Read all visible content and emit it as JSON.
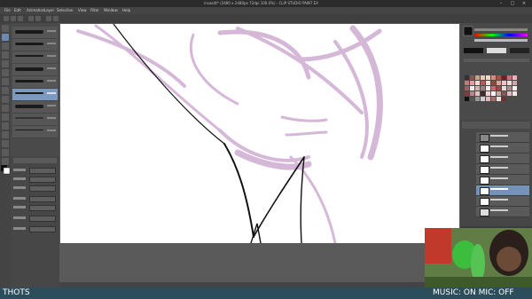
{
  "window": {
    "title": "insaaitt* (2480 x 2480px 72dpi 100.0%) - CLIP STUDIO PAINT EX",
    "minimize_icon": "minimize-icon",
    "maximize_icon": "maximize-icon",
    "close_icon": "close-icon"
  },
  "menu": {
    "items": [
      "File",
      "Edit",
      "Animation",
      "Layer",
      "Selection",
      "View",
      "Filter",
      "Window",
      "Help"
    ]
  },
  "tool_palette": {
    "icons": [
      "pen-icon",
      "pencil-icon",
      "brush-icon",
      "eraser-icon",
      "fill-icon",
      "select-icon",
      "move-icon",
      "eyedropper-icon",
      "hand-icon",
      "zoom-icon",
      "text-icon",
      "figure-icon",
      "lasso-icon",
      "ruler-icon",
      "gradient-icon",
      "blend-icon"
    ]
  },
  "colors": {
    "accent": "#7b9ac0",
    "canvas": "#ffffff",
    "sketch_stroke": "#b37fb9",
    "ink_stroke": "#111111",
    "stream_bar": "#2c4d5b"
  },
  "stream_overlay": {
    "left_text": "THOTS",
    "right_text": "MUSIC: ON MIC: OFF"
  }
}
